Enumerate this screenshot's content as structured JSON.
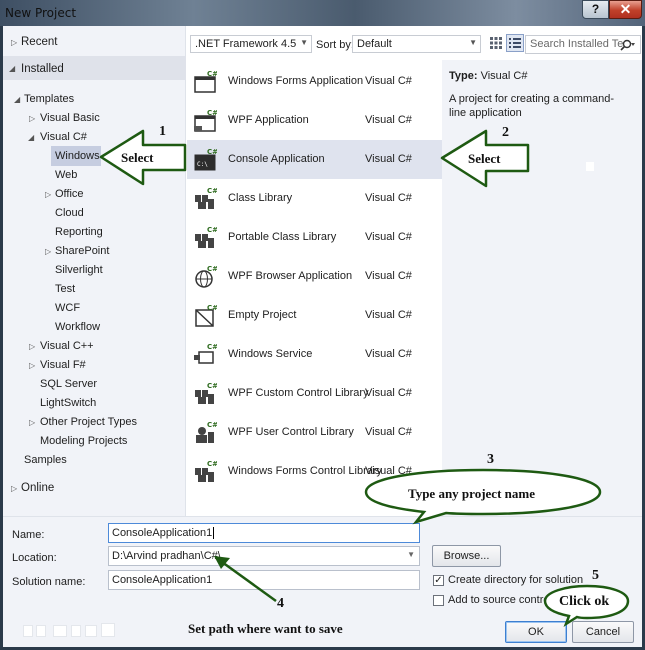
{
  "window": {
    "title": "New Project",
    "help_label": "?",
    "close_label": "✕"
  },
  "tree": {
    "recent": "Recent",
    "installed": "Installed",
    "templates": "Templates",
    "visual_basic": "Visual Basic",
    "visual_csharp": "Visual C#",
    "windows": "Windows",
    "web": "Web",
    "office": "Office",
    "cloud": "Cloud",
    "reporting": "Reporting",
    "sharepoint": "SharePoint",
    "silverlight": "Silverlight",
    "test": "Test",
    "wcf": "WCF",
    "workflow": "Workflow",
    "visual_cpp": "Visual C++",
    "visual_fsharp": "Visual F#",
    "sql_server": "SQL Server",
    "lightswitch": "LightSwitch",
    "other_project_types": "Other Project Types",
    "modeling_projects": "Modeling Projects",
    "samples": "Samples",
    "online": "Online"
  },
  "toolbar": {
    "framework": ".NET Framework 4.5",
    "sort_by_label": "Sort by:",
    "sort_by_value": "Default",
    "search_placeholder": "Search Installed Te"
  },
  "templates": [
    {
      "name": "Windows Forms Application",
      "lang": "Visual C#",
      "icon": "winforms-app-icon"
    },
    {
      "name": "WPF Application",
      "lang": "Visual C#",
      "icon": "wpf-app-icon"
    },
    {
      "name": "Console Application",
      "lang": "Visual C#",
      "icon": "console-app-icon"
    },
    {
      "name": "Class Library",
      "lang": "Visual C#",
      "icon": "class-library-icon"
    },
    {
      "name": "Portable Class Library",
      "lang": "Visual C#",
      "icon": "portable-class-library-icon"
    },
    {
      "name": "WPF Browser Application",
      "lang": "Visual C#",
      "icon": "wpf-browser-app-icon"
    },
    {
      "name": "Empty Project",
      "lang": "Visual C#",
      "icon": "empty-project-icon"
    },
    {
      "name": "Windows Service",
      "lang": "Visual C#",
      "icon": "windows-service-icon"
    },
    {
      "name": "WPF Custom Control Library",
      "lang": "Visual C#",
      "icon": "wpf-custom-control-icon"
    },
    {
      "name": "WPF User Control Library",
      "lang": "Visual C#",
      "icon": "wpf-user-control-icon"
    },
    {
      "name": "Windows Forms Control Library",
      "lang": "Visual C#",
      "icon": "winforms-control-icon"
    }
  ],
  "info": {
    "type_label": "Type:",
    "type_value": "Visual C#",
    "description": "A project for creating a command-line application"
  },
  "form": {
    "name_label": "Name:",
    "name_value": "ConsoleApplication1",
    "location_label": "Location:",
    "location_value": "D:\\Arvind pradhan\\C#\\",
    "solution_label": "Solution name:",
    "solution_value": "ConsoleApplication1",
    "browse_label": "Browse...",
    "create_dir_label": "Create directory for solution",
    "add_source_label": "Add to source control",
    "ok_label": "OK",
    "cancel_label": "Cancel"
  },
  "annotations": {
    "n1": "1",
    "select1": "Select",
    "n2": "2",
    "select2": "Select",
    "n3": "3",
    "type_name": "Type any project name",
    "n4": "4",
    "set_path": "Set path where want to save",
    "n5": "5",
    "click_ok": "Click ok"
  },
  "colors": {
    "accent_green": "#1e5a12",
    "selected_row": "#dfe3ee",
    "panel_bg": "#f1f3f8"
  }
}
